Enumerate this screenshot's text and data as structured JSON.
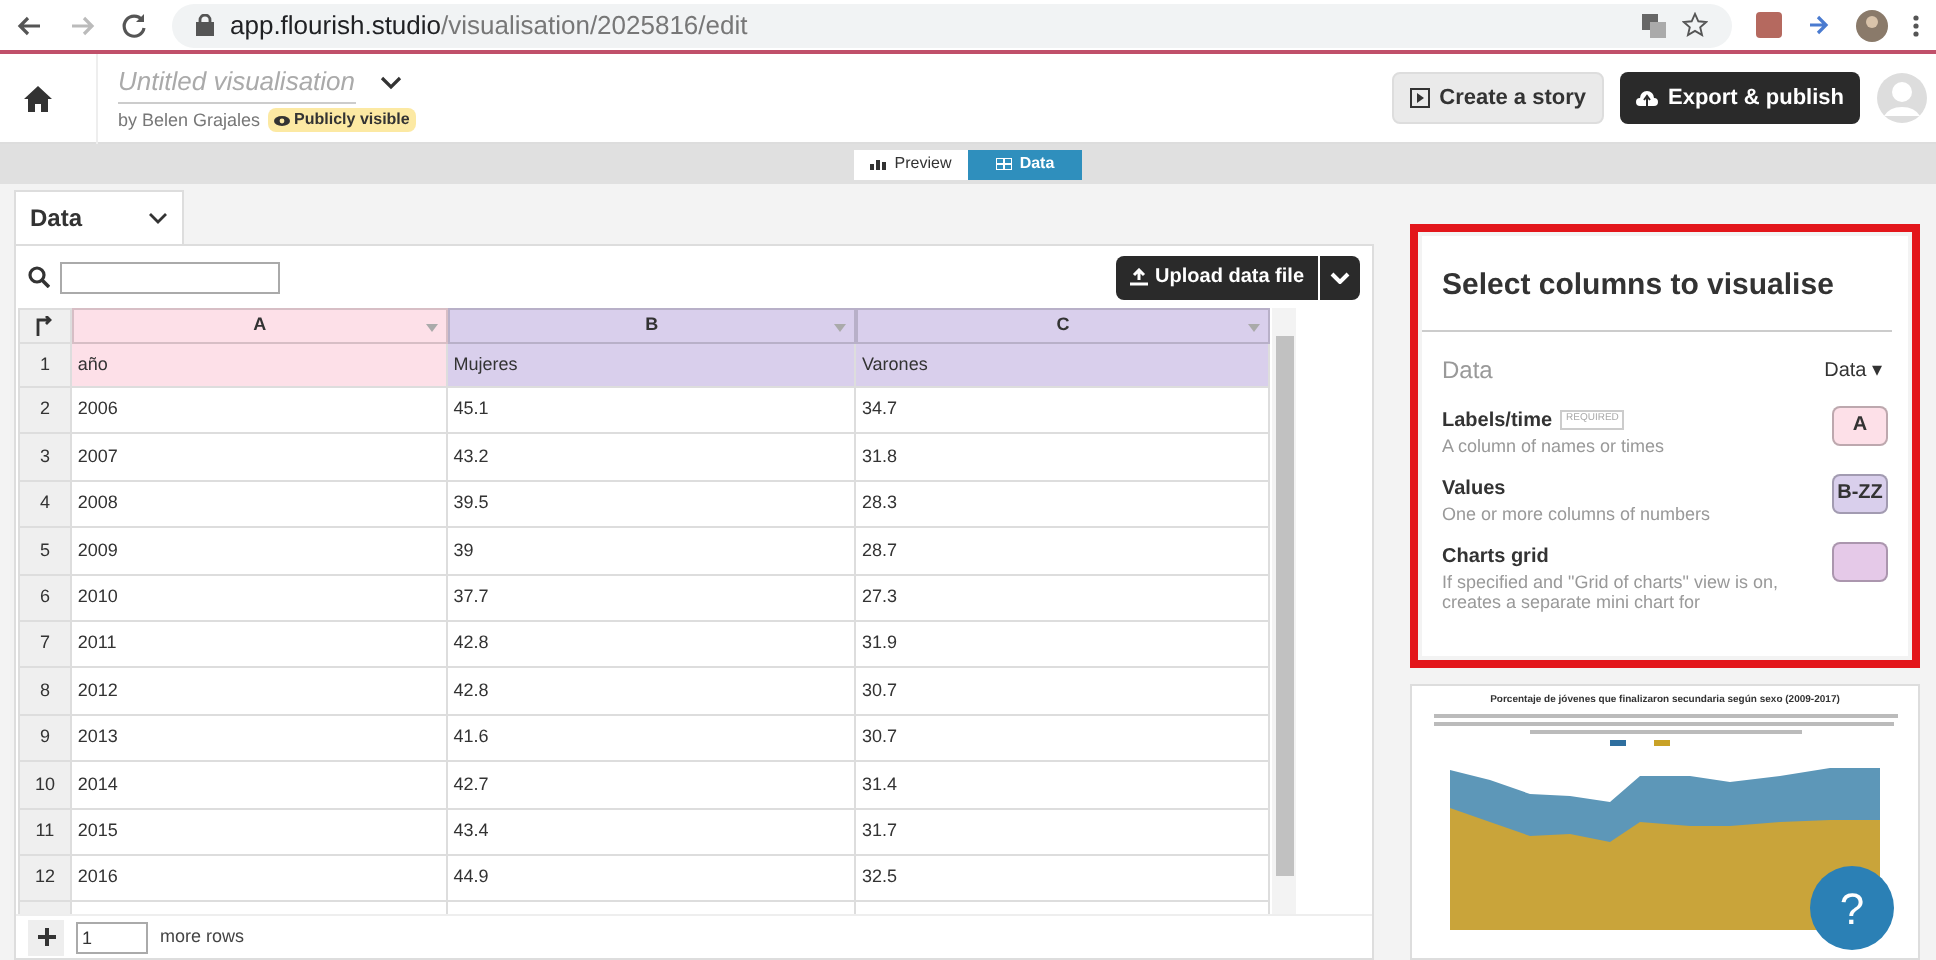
{
  "browser": {
    "url_host": "app.flourish.studio",
    "url_path": "/visualisation/2025816/edit"
  },
  "header": {
    "title": "Untitled visualisation",
    "byline": "by Belen Grajales",
    "visibility_badge": "Publicly visible",
    "buttons": [
      {
        "label": "Create a story",
        "kind": "light"
      },
      {
        "label": "Export & publish",
        "kind": "dark"
      }
    ]
  },
  "view_tabs": [
    {
      "label": "Preview",
      "selected": false
    },
    {
      "label": "Data",
      "selected": true
    }
  ],
  "sheet_tab": {
    "label": "Data"
  },
  "upload_button": "Upload data file",
  "table": {
    "columns": [
      {
        "letter": "A",
        "color": "#fde0e8"
      },
      {
        "letter": "B",
        "color": "#d9cfec"
      },
      {
        "letter": "C",
        "color": "#d9cfec"
      }
    ],
    "rows": [
      {
        "num": "1",
        "cells": [
          "año",
          "Mujeres",
          "Varones"
        ]
      },
      {
        "num": "2",
        "cells": [
          "2006",
          "45.1",
          "34.7"
        ]
      },
      {
        "num": "3",
        "cells": [
          "2007",
          "43.2",
          "31.8"
        ]
      },
      {
        "num": "4",
        "cells": [
          "2008",
          "39.5",
          "28.3"
        ]
      },
      {
        "num": "5",
        "cells": [
          "2009",
          "39",
          "28.7"
        ]
      },
      {
        "num": "6",
        "cells": [
          "2010",
          "37.7",
          "27.3"
        ]
      },
      {
        "num": "7",
        "cells": [
          "2011",
          "42.8",
          "31.9"
        ]
      },
      {
        "num": "8",
        "cells": [
          "2012",
          "42.8",
          "30.7"
        ]
      },
      {
        "num": "9",
        "cells": [
          "2013",
          "41.6",
          "30.7"
        ]
      },
      {
        "num": "10",
        "cells": [
          "2014",
          "42.7",
          "31.4"
        ]
      },
      {
        "num": "11",
        "cells": [
          "2015",
          "43.4",
          "31.7"
        ]
      },
      {
        "num": "12",
        "cells": [
          "2016",
          "44.9",
          "32.5"
        ]
      }
    ]
  },
  "add_rows": {
    "value": "1",
    "label": "more rows"
  },
  "panel": {
    "title": "Select columns to visualise",
    "section": "Data",
    "sheet_select": "Data ▾",
    "bindings": [
      {
        "label": "Labels/time",
        "required_tag": "REQUIRED",
        "hint": "A column of names or times",
        "value": "A",
        "color": "#fde0e8"
      },
      {
        "label": "Values",
        "hint": "One or more columns of numbers",
        "value": "B-ZZ",
        "color": "#d9cfec"
      },
      {
        "label": "Charts grid",
        "hint": "If specified and \"Grid of charts\" view is on, creates a separate mini chart for",
        "color": "#e5c9e8"
      }
    ]
  },
  "preview": {
    "title": "Porcentaje de jóvenes que finalizaron secundaria según sexo (2009-2017)"
  },
  "help_button": "?"
}
